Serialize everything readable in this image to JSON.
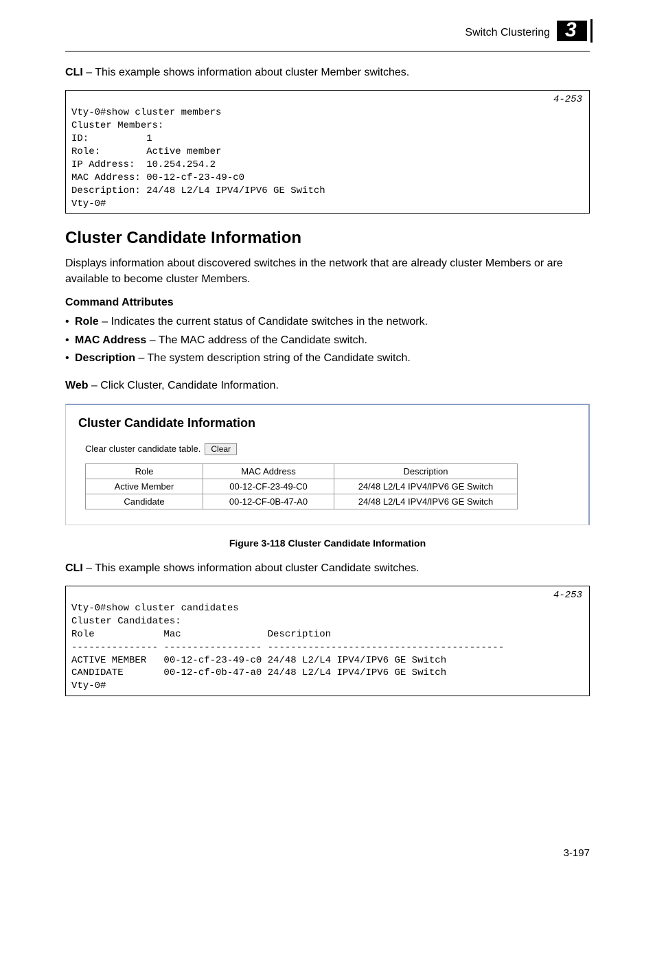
{
  "header": {
    "section": "Switch Clustering",
    "chapter_number": "3"
  },
  "cli_members": {
    "intro_prefix": "CLI",
    "intro_text": " – This example shows information about cluster Member switches.",
    "ref": "4-253",
    "lines": "Vty-0#show cluster members\nCluster Members:\nID:          1\nRole:        Active member\nIP Address:  10.254.254.2\nMAC Address: 00-12-cf-23-49-c0\nDescription: 24/48 L2/L4 IPV4/IPV6 GE Switch\nVty-0#"
  },
  "section": {
    "title": "Cluster Candidate Information",
    "desc": "Displays information about discovered switches in the network that are already cluster Members or are available to become cluster Members.",
    "cmd_attr_heading": "Command Attributes",
    "bullets": [
      {
        "term": "Role",
        "text": " – Indicates the current status of Candidate switches in the network."
      },
      {
        "term": "MAC Address",
        "text": " – The MAC address of the Candidate switch."
      },
      {
        "term": "Description",
        "text": " – The system description string of the Candidate switch."
      }
    ],
    "web_prefix": "Web",
    "web_text": " – Click Cluster, Candidate Information."
  },
  "panel": {
    "title": "Cluster Candidate Information",
    "clear_label": "Clear cluster candidate table.",
    "clear_button": "Clear",
    "headers": [
      "Role",
      "MAC Address",
      "Description"
    ],
    "rows": [
      [
        "Active Member",
        "00-12-CF-23-49-C0",
        "24/48 L2/L4 IPV4/IPV6 GE Switch"
      ],
      [
        "Candidate",
        "00-12-CF-0B-47-A0",
        "24/48 L2/L4 IPV4/IPV6 GE Switch"
      ]
    ]
  },
  "figure_caption": "Figure 3-118  Cluster Candidate Information",
  "cli_candidates": {
    "intro_prefix": "CLI",
    "intro_text": " – This example shows information about cluster Candidate switches.",
    "ref": "4-253",
    "lines": "Vty-0#show cluster candidates\nCluster Candidates:\nRole            Mac               Description\n--------------- ----------------- -----------------------------------------\nACTIVE MEMBER   00-12-cf-23-49-c0 24/48 L2/L4 IPV4/IPV6 GE Switch\nCANDIDATE       00-12-cf-0b-47-a0 24/48 L2/L4 IPV4/IPV6 GE Switch\nVty-0#"
  },
  "page_number": "3-197"
}
